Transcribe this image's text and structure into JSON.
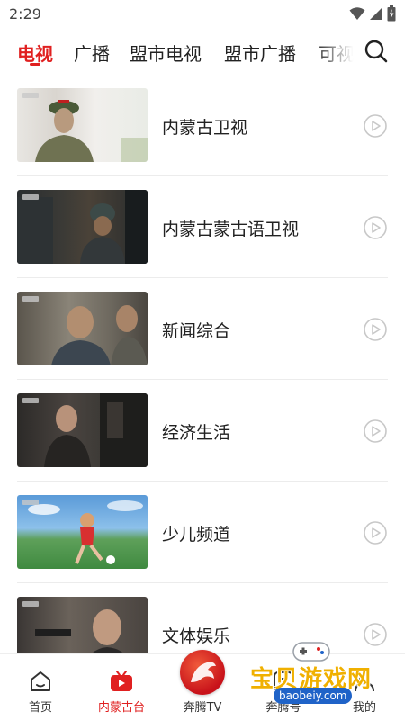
{
  "status_bar": {
    "time": "2:29"
  },
  "top_tabs": {
    "items": [
      "电视",
      "广播",
      "盟市电视",
      "盟市广播",
      "可视"
    ],
    "active_index": 0
  },
  "channels": [
    {
      "name": "内蒙古卫视"
    },
    {
      "name": "内蒙古蒙古语卫视"
    },
    {
      "name": "新闻综合"
    },
    {
      "name": "经济生活"
    },
    {
      "name": "少儿频道"
    },
    {
      "name": "文体娱乐"
    }
  ],
  "bottom_nav": {
    "items": [
      {
        "label": "首页",
        "icon": "home-icon"
      },
      {
        "label": "内蒙古台",
        "icon": "tv-icon"
      },
      {
        "label": "奔腾TV",
        "icon": "horse-logo"
      },
      {
        "label": "奔腾号",
        "icon": "feed-icon"
      },
      {
        "label": "我的",
        "icon": "profile-icon"
      }
    ],
    "active_index": 1
  },
  "watermark": {
    "title": "宝贝游戏网",
    "url": "baobeiy.com"
  },
  "colors": {
    "accent": "#e02020",
    "text": "#222222",
    "divider": "#ececec"
  }
}
